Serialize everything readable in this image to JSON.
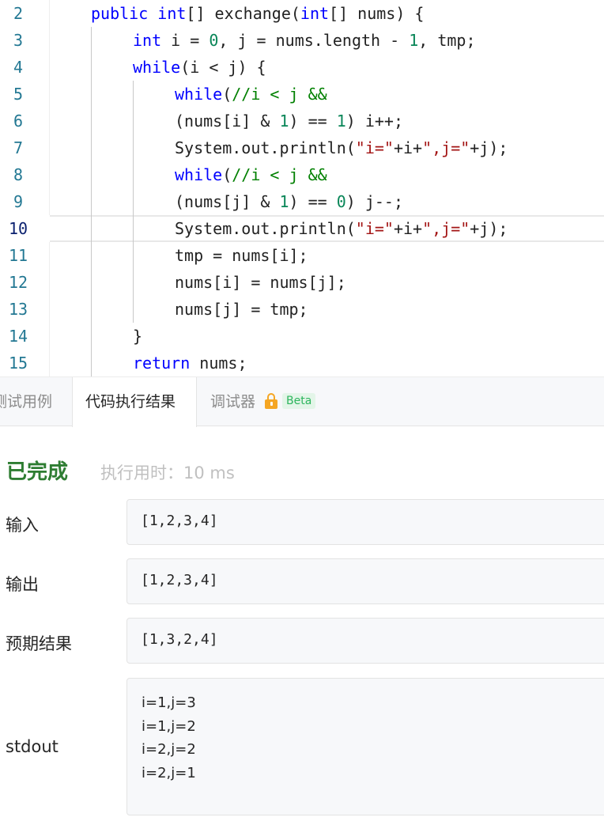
{
  "editor": {
    "lines": [
      {
        "num": "2"
      },
      {
        "num": "3"
      },
      {
        "num": "4"
      },
      {
        "num": "5"
      },
      {
        "num": "6"
      },
      {
        "num": "7"
      },
      {
        "num": "8"
      },
      {
        "num": "9"
      },
      {
        "num": "10"
      },
      {
        "num": "11"
      },
      {
        "num": "12"
      },
      {
        "num": "13"
      },
      {
        "num": "14"
      },
      {
        "num": "15"
      }
    ],
    "code": {
      "l2": {
        "kw1": "public",
        "kw2": "int",
        "t1": "[] exchange(",
        "kw3": "int",
        "t2": "[] nums) {"
      },
      "l3": {
        "kw1": "int",
        "t1": " i = ",
        "n1": "0",
        "t2": ", j = nums.length - ",
        "n2": "1",
        "t3": ", tmp;"
      },
      "l4": {
        "kw1": "while",
        "t1": "(i < j) {"
      },
      "l5": {
        "kw1": "while",
        "t1": "(",
        "c1": "//i < j &&"
      },
      "l6": {
        "t1": "(nums[i] & ",
        "n1": "1",
        "t2": ") == ",
        "n2": "1",
        "t3": ") i++;"
      },
      "l7": {
        "t1": "System.out.println(",
        "s1": "\"i=\"",
        "t2": "+i+",
        "s2": "\",j=\"",
        "t3": "+j);"
      },
      "l8": {
        "kw1": "while",
        "t1": "(",
        "c1": "//i < j &&"
      },
      "l9": {
        "t1": "(nums[j] & ",
        "n1": "1",
        "t2": ") == ",
        "n2": "0",
        "t3": ") j--;"
      },
      "l10": {
        "t1": "System.out.println(",
        "s1": "\"i=\"",
        "t2": "+i+",
        "s2": "\",j=\"",
        "t3": "+j);"
      },
      "l11": {
        "t1": "tmp = nums[i];"
      },
      "l12": {
        "t1": "nums[i] = nums[j];"
      },
      "l13": {
        "t1": "nums[j] = tmp;"
      },
      "l14": {
        "t1": "}"
      },
      "l15": {
        "kw1": "return",
        "t1": " nums;"
      }
    }
  },
  "tabs": {
    "testcase": "测试用例",
    "result": "代码执行结果",
    "debugger": "调试器",
    "beta": "Beta"
  },
  "result": {
    "status": "已完成",
    "runtime_label": "执行用时：",
    "runtime_value": "10 ms",
    "input_label": "输入",
    "input_value": "[1,2,3,4]",
    "output_label": "输出",
    "output_value": "[1,2,3,4]",
    "expected_label": "预期结果",
    "expected_value": "[1,3,2,4]",
    "stdout_label": "stdout",
    "stdout_lines": [
      "i=1,j=3",
      "i=1,j=2",
      "i=2,j=2",
      "i=2,j=1"
    ]
  },
  "colors": {
    "keyword": "#0000ff",
    "keyword_control": "#008000",
    "number": "#098658",
    "string": "#a31515",
    "status_done": "#2e7d32",
    "beta_badge": "#2db55d",
    "lock": "#f5a623"
  }
}
